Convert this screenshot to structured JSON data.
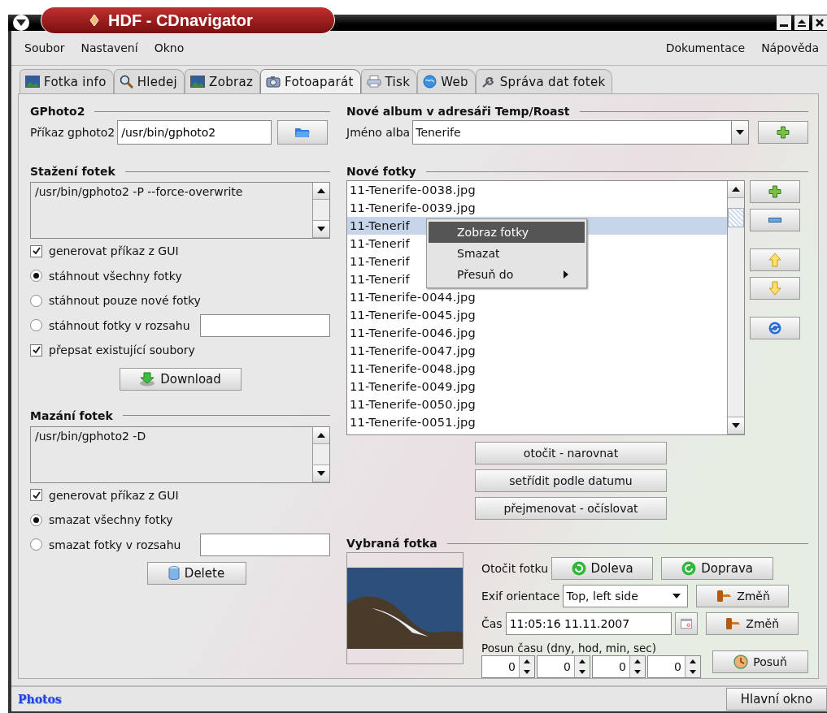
{
  "window": {
    "title": "HDF - CDnavigator"
  },
  "menu_bar": {
    "left": [
      {
        "label": "Soubor"
      },
      {
        "label": "Nastavení"
      },
      {
        "label": "Okno"
      }
    ],
    "right": [
      {
        "label": "Dokumentace"
      },
      {
        "label": "Nápověda"
      }
    ]
  },
  "tabs": [
    {
      "label": "Fotka info",
      "selected": false,
      "kind": "picture"
    },
    {
      "label": "Hledej",
      "selected": false,
      "kind": "search"
    },
    {
      "label": "Zobraz",
      "selected": false,
      "kind": "picture"
    },
    {
      "label": "Fotoaparát",
      "selected": true,
      "kind": "camera"
    },
    {
      "label": "Tisk",
      "selected": false,
      "kind": "printer"
    },
    {
      "label": "Web",
      "selected": false,
      "kind": "globe"
    },
    {
      "label": "Správa dat fotek",
      "selected": false,
      "kind": "wrench"
    }
  ],
  "gphoto2": {
    "title": "GPhoto2",
    "command_label": "Příkaz gphoto2",
    "command_value": "/usr/bin/gphoto2"
  },
  "download": {
    "title": "Stažení fotek",
    "command": "/usr/bin/gphoto2 -P  --force-overwrite",
    "options": [
      {
        "kind": "checkbox",
        "label": "generovat příkaz z GUI",
        "checked": true
      },
      {
        "kind": "radio",
        "label": "stáhnout všechny fotky",
        "selected": true
      },
      {
        "kind": "radio",
        "label": "stáhnout pouze nové fotky",
        "selected": false
      },
      {
        "kind": "radio_range",
        "label": "stáhnout fotky v rozsahu",
        "selected": false
      },
      {
        "kind": "checkbox",
        "label": "přepsat existující soubory",
        "checked": true
      }
    ],
    "button": "Download"
  },
  "delete": {
    "title": "Mazání fotek",
    "command": "/usr/bin/gphoto2 -D",
    "options": [
      {
        "kind": "checkbox",
        "label": "generovat příkaz z GUI",
        "checked": true
      },
      {
        "kind": "radio",
        "label": "smazat všechny fotky",
        "selected": true
      },
      {
        "kind": "radio_range",
        "label": "smazat fotky v rozsahu",
        "selected": false
      }
    ],
    "button": "Delete"
  },
  "new_album": {
    "title": "Nové album v adresáři Temp/Roast",
    "name_label": "Jméno alba",
    "name_value": "Tenerife"
  },
  "new_photos": {
    "title": "Nové fotky",
    "files": [
      {
        "name": "11-Tenerife-0038.jpg",
        "selected": false
      },
      {
        "name": "11-Tenerife-0039.jpg",
        "selected": false
      },
      {
        "name": "11-Tenerif",
        "selected": true
      },
      {
        "name": "11-Tenerif",
        "selected": false
      },
      {
        "name": "11-Tenerif",
        "selected": false
      },
      {
        "name": "11-Tenerif",
        "selected": false
      },
      {
        "name": "11-Tenerife-0044.jpg",
        "selected": false
      },
      {
        "name": "11-Tenerife-0045.jpg",
        "selected": false
      },
      {
        "name": "11-Tenerife-0046.jpg",
        "selected": false
      },
      {
        "name": "11-Tenerife-0047.jpg",
        "selected": false
      },
      {
        "name": "11-Tenerife-0048.jpg",
        "selected": false
      },
      {
        "name": "11-Tenerife-0049.jpg",
        "selected": false
      },
      {
        "name": "11-Tenerife-0050.jpg",
        "selected": false
      },
      {
        "name": "11-Tenerife-0051.jpg",
        "selected": false
      }
    ],
    "context_menu": [
      {
        "label": "Zobraz fotky",
        "selected": true,
        "submenu": false
      },
      {
        "label": "Smazat",
        "selected": false,
        "submenu": false
      },
      {
        "label": "Přesuň do",
        "selected": false,
        "submenu": true
      }
    ],
    "actions": [
      "otočit - narovnat",
      "setřídit podle datumu",
      "přejmenovat - očíslovat"
    ]
  },
  "selected_photo": {
    "title": "Vybraná fotka",
    "rotate_label": "Otočit fotku",
    "rotate_left": "Doleva",
    "rotate_right": "Doprava",
    "exif_label": "Exif orientace",
    "exif_value": "Top, left side",
    "exif_change": "Změň",
    "time_label": "Čas",
    "time_value": "11:05:16 11.11.2007",
    "time_change": "Změň",
    "shift_label": "Posun času (dny, hod, min, sec)",
    "shift_values": [
      "0",
      "0",
      "0",
      "0"
    ],
    "shift_button": "Posuň"
  },
  "status_bar": {
    "logo": "Photos",
    "button": "Hlavní okno"
  }
}
